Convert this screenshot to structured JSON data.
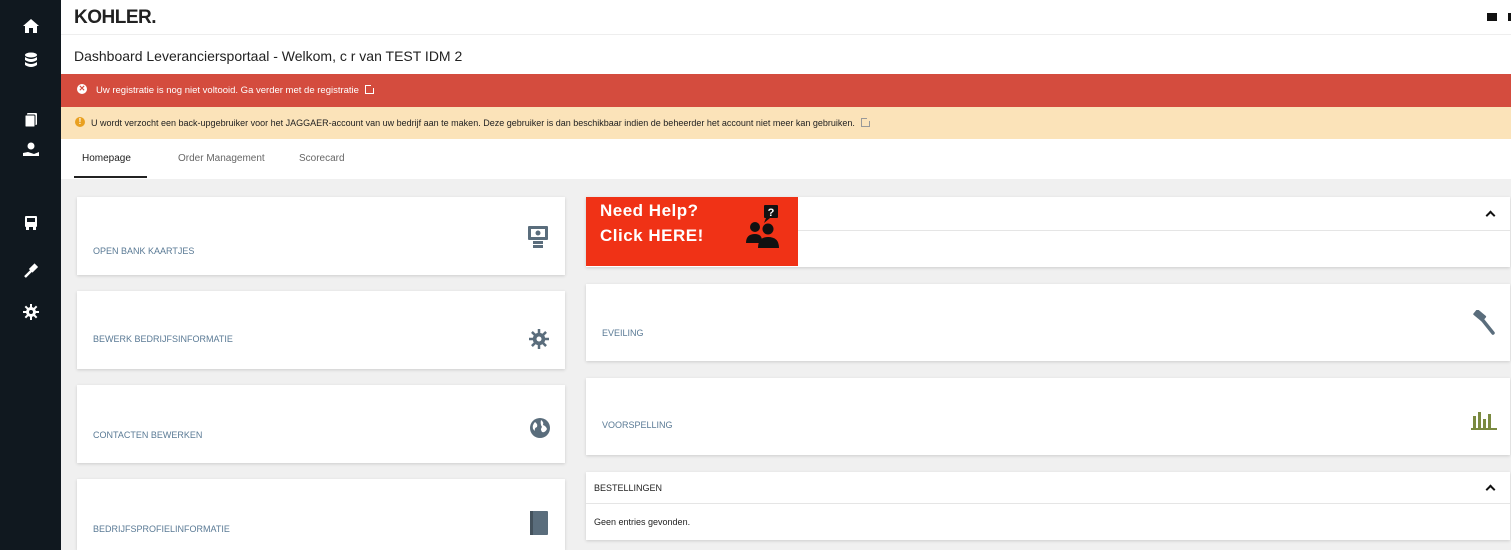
{
  "app": {
    "logo": "KOHLER",
    "title": "Dashboard Leveranciersportaal - Welkom, c r van TEST IDM 2"
  },
  "sidebar": {
    "items": [
      {
        "icon": "home-icon"
      },
      {
        "icon": "database-icon"
      },
      {
        "icon": "documents-icon"
      },
      {
        "icon": "supplier-hand-icon"
      },
      {
        "icon": "truck-icon"
      },
      {
        "icon": "auction-hammer-icon"
      },
      {
        "icon": "gear-icon"
      }
    ]
  },
  "alerts": {
    "registration": "Uw registratie is nog niet voltooid. Ga verder met de registratie",
    "backup_user": "U wordt verzocht een back-upgebruiker voor het JAGGAER-account van uw bedrijf aan te maken. Deze gebruiker is dan beschikbaar indien de beheerder het account niet meer kan gebruiken."
  },
  "tabs": [
    {
      "label": "Homepage",
      "active": true
    },
    {
      "label": "Order Management",
      "active": false
    },
    {
      "label": "Scorecard",
      "active": false
    }
  ],
  "left_cards": [
    {
      "label": "OPEN BANK KAARTJES",
      "icon": "bank-cards-icon"
    },
    {
      "label": "BEWERK BEDRIJFSINFORMATIE",
      "icon": "gear-icon"
    },
    {
      "label": "CONTACTEN BEWERKEN",
      "icon": "globe-icon"
    },
    {
      "label": "BEDRIJFSPROFIELINFORMATIE",
      "icon": "book-icon"
    }
  ],
  "help_banner": {
    "line1": "Need Help?",
    "line2": "Click HERE!"
  },
  "right_cards": [
    {
      "label": "EVEILING",
      "icon": "auction-hammer-icon"
    },
    {
      "label": "VOORSPELLING",
      "icon": "bar-chart-icon"
    }
  ],
  "orders": {
    "title": "BESTELLINGEN",
    "empty": "Geen entries gevonden."
  },
  "colors": {
    "sidebar": "#10181f",
    "alert_red": "#d44c3e",
    "alert_yellow": "#fbe3b9",
    "help_red": "#f03216",
    "label_blue": "#5a7a95"
  }
}
